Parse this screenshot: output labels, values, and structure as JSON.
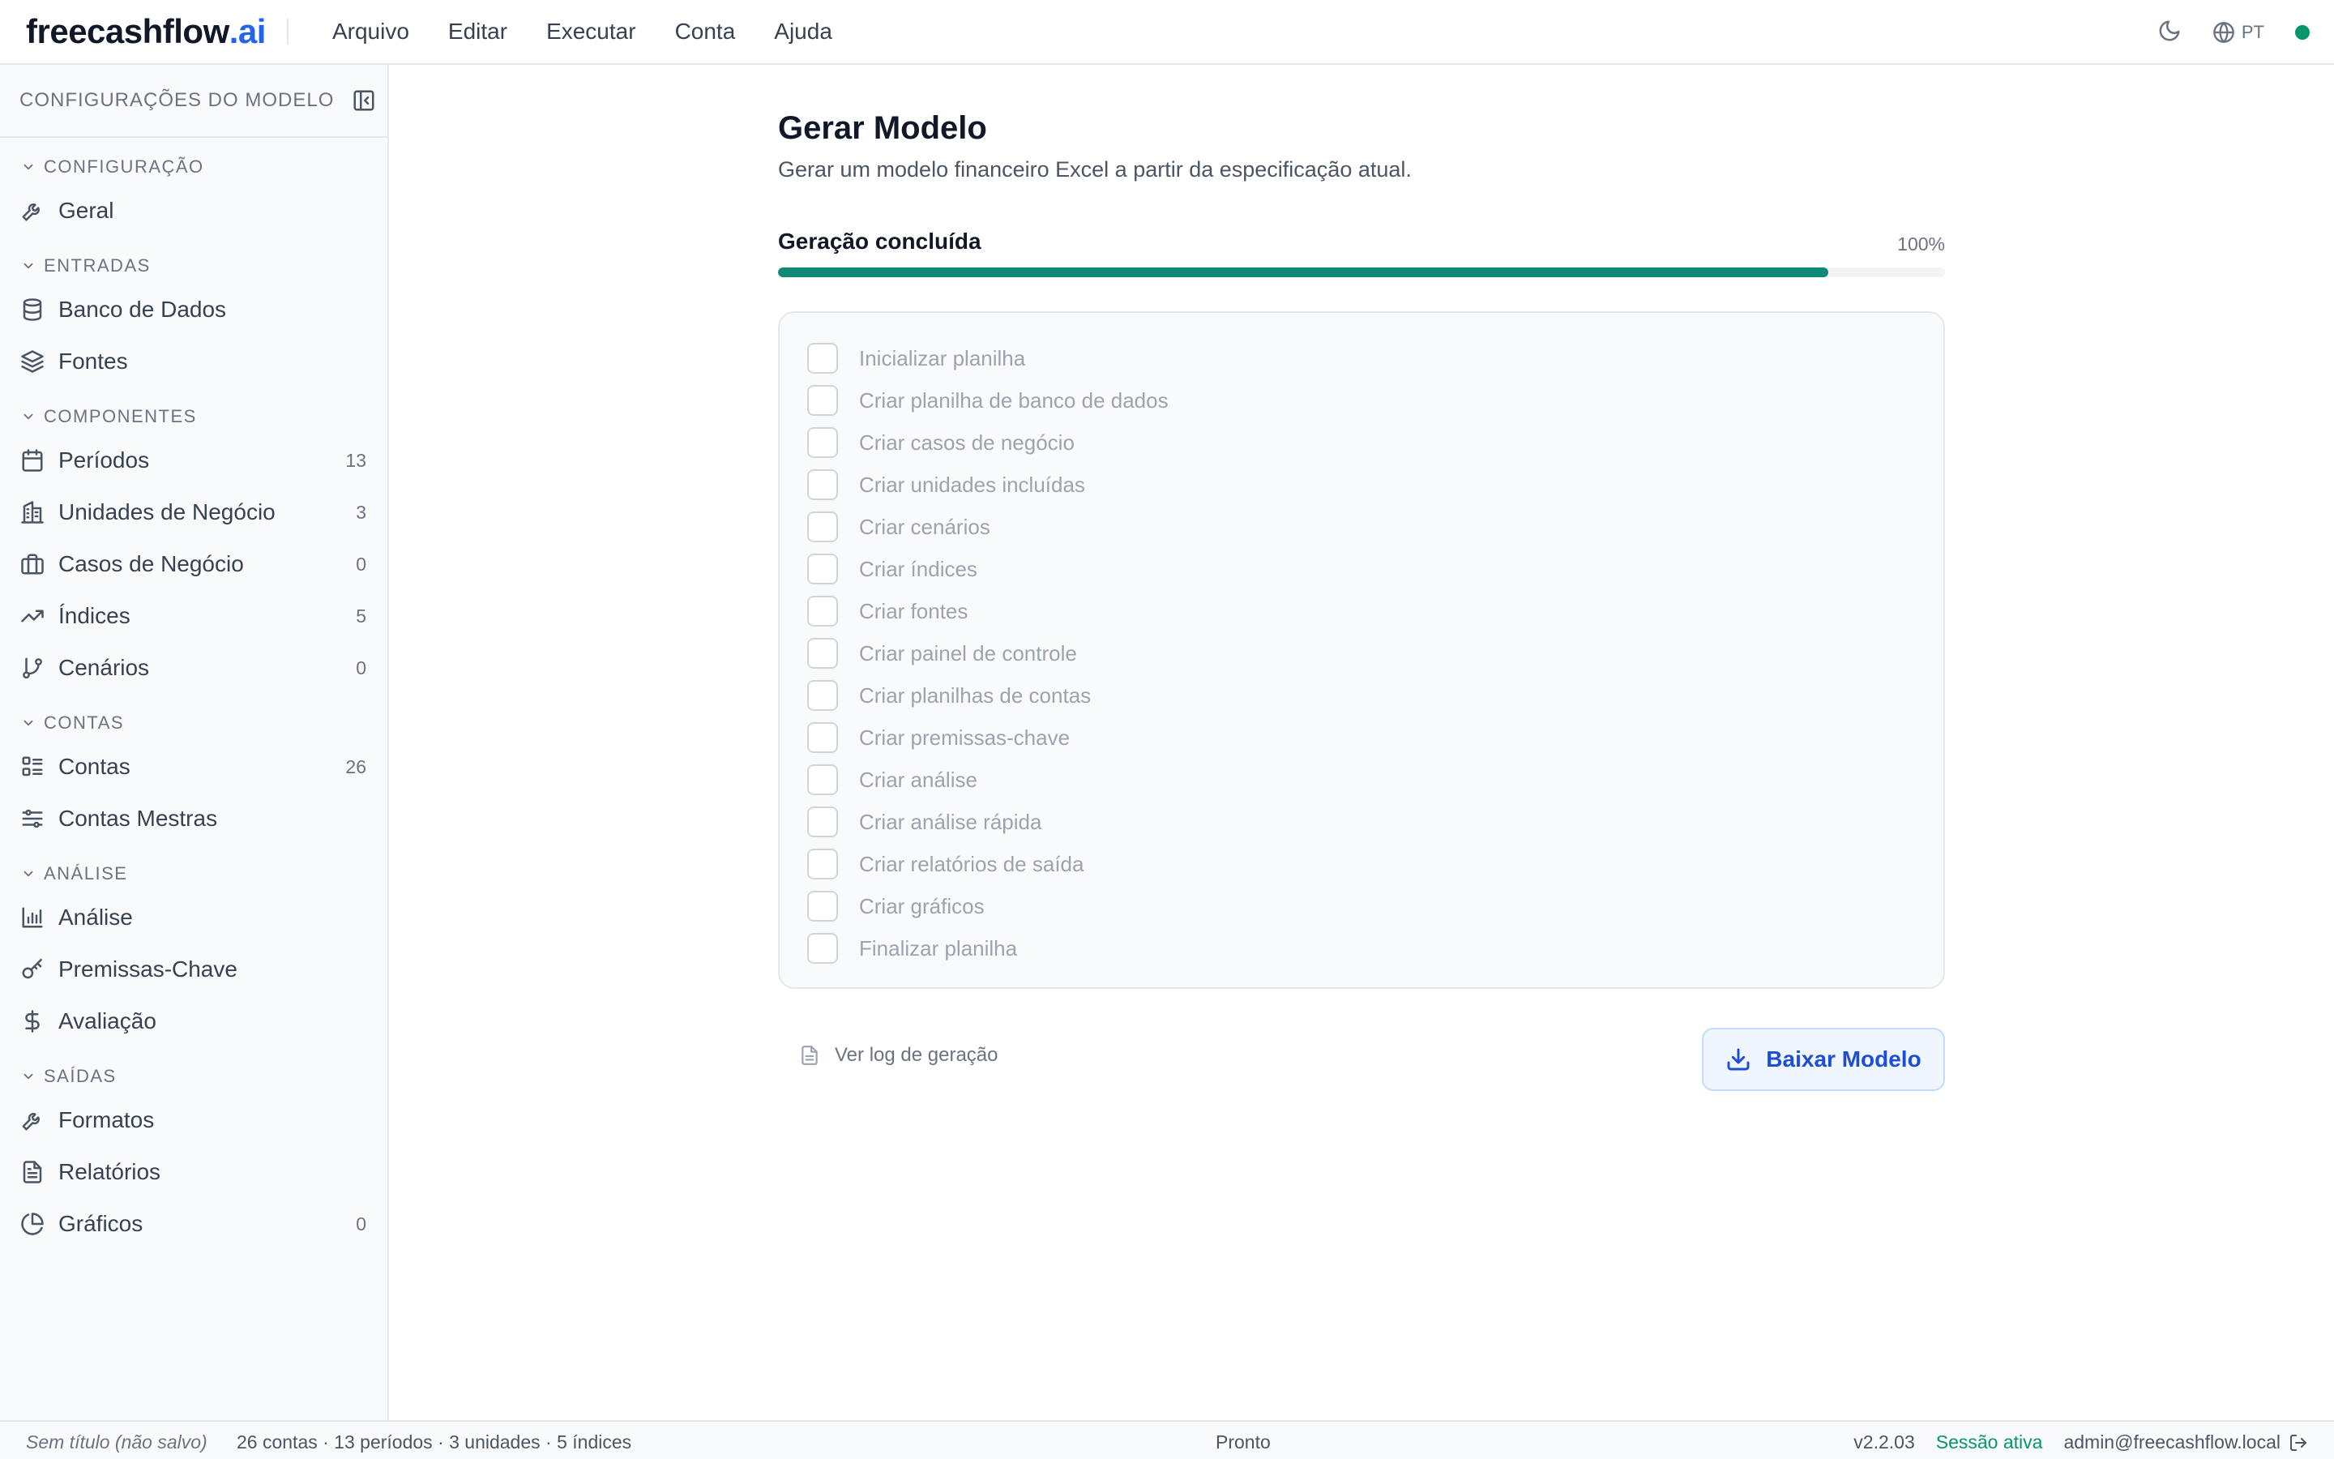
{
  "brand": {
    "name": "freecashflow",
    "suffix": ".ai",
    "accent": "#2563eb"
  },
  "menu": [
    "Arquivo",
    "Editar",
    "Executar",
    "Conta",
    "Ajuda"
  ],
  "topbar": {
    "language": "PT",
    "theme_icon": "moon-icon",
    "status_color": "#059669"
  },
  "sidebar": {
    "header": "CONFIGURAÇÕES DO MODELO",
    "sections": [
      {
        "title": "CONFIGURAÇÃO",
        "items": [
          {
            "label": "Geral",
            "icon": "wrench-icon",
            "count": ""
          }
        ]
      },
      {
        "title": "ENTRADAS",
        "items": [
          {
            "label": "Banco de Dados",
            "icon": "database-icon",
            "count": ""
          },
          {
            "label": "Fontes",
            "icon": "layers-icon",
            "count": ""
          }
        ]
      },
      {
        "title": "COMPONENTES",
        "items": [
          {
            "label": "Períodos",
            "icon": "calendar-icon",
            "count": "13"
          },
          {
            "label": "Unidades de Negócio",
            "icon": "building-icon",
            "count": "3"
          },
          {
            "label": "Casos de Negócio",
            "icon": "briefcase-icon",
            "count": "0"
          },
          {
            "label": "Índices",
            "icon": "trending-up-icon",
            "count": "5"
          },
          {
            "label": "Cenários",
            "icon": "git-branch-icon",
            "count": "0"
          }
        ]
      },
      {
        "title": "CONTAS",
        "items": [
          {
            "label": "Contas",
            "icon": "list-icon",
            "count": "26"
          },
          {
            "label": "Contas Mestras",
            "icon": "sliders-icon",
            "count": ""
          }
        ]
      },
      {
        "title": "ANÁLISE",
        "items": [
          {
            "label": "Análise",
            "icon": "bar-chart-icon",
            "count": ""
          },
          {
            "label": "Premissas-Chave",
            "icon": "key-icon",
            "count": ""
          },
          {
            "label": "Avaliação",
            "icon": "dollar-icon",
            "count": ""
          }
        ]
      },
      {
        "title": "SAÍDAS",
        "items": [
          {
            "label": "Formatos",
            "icon": "wrench-icon",
            "count": ""
          },
          {
            "label": "Relatórios",
            "icon": "file-text-icon",
            "count": ""
          },
          {
            "label": "Gráficos",
            "icon": "pie-chart-icon",
            "count": "0"
          }
        ]
      }
    ]
  },
  "main": {
    "title": "Gerar Modelo",
    "subtitle": "Gerar um modelo financeiro Excel a partir da especificação atual.",
    "progress": {
      "label": "Geração concluída",
      "percent_text": "100%",
      "fill_fraction": 0.9,
      "fill_color": "#0f8a72"
    },
    "steps": [
      "Inicializar planilha",
      "Criar planilha de banco de dados",
      "Criar casos de negócio",
      "Criar unidades incluídas",
      "Criar cenários",
      "Criar índices",
      "Criar fontes",
      "Criar painel de controle",
      "Criar planilhas de contas",
      "Criar premissas-chave",
      "Criar análise",
      "Criar análise rápida",
      "Criar relatórios de saída",
      "Criar gráficos",
      "Finalizar planilha"
    ],
    "log_link": "Ver log de geração",
    "download_button": "Baixar Modelo"
  },
  "statusbar": {
    "file": "Sem título (não salvo)",
    "stats": "26 contas · 13 períodos · 3 unidades · 5 índices",
    "state": "Pronto",
    "version": "v2.2.03",
    "session": "Sessão ativa",
    "user": "admin@freecashflow.local"
  }
}
